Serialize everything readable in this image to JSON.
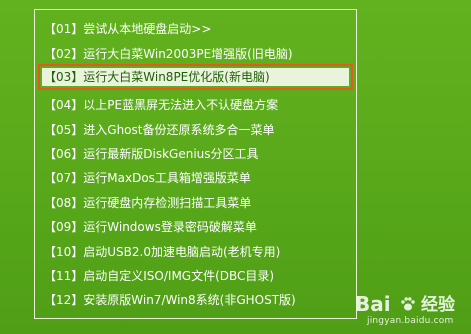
{
  "menu": {
    "items": [
      {
        "label": "【01】尝试从本地硬盘启动>>",
        "selected": false
      },
      {
        "label": "【02】运行大白菜Win2003PE增强版(旧电脑)",
        "selected": false
      },
      {
        "label": "【03】运行大白菜Win8PE优化版(新电脑)",
        "selected": true
      },
      {
        "label": "【04】以上PE蓝黑屏无法进入不认硬盘方案",
        "selected": false
      },
      {
        "label": "【05】进入Ghost备份还原系统多合一菜单",
        "selected": false
      },
      {
        "label": "【06】运行最新版DiskGenius分区工具",
        "selected": false
      },
      {
        "label": "【07】运行MaxDos工具箱增强版菜单",
        "selected": false
      },
      {
        "label": "【08】运行硬盘内存检测扫描工具菜单",
        "selected": false
      },
      {
        "label": "【09】运行Windows登录密码破解菜单",
        "selected": false
      },
      {
        "label": "【10】启动USB2.0加速电脑启动(老机专用)",
        "selected": false
      },
      {
        "label": "【11】启动自定义ISO/IMG文件(DBC目录)",
        "selected": false
      },
      {
        "label": "【12】安装原版Win7/Win8系统(非GHOST版)",
        "selected": false
      }
    ]
  },
  "watermark": {
    "logo": "Bai",
    "suffix": "经验",
    "url": "jingyan.baidu.com"
  },
  "colors": {
    "background": "#5cad1c",
    "selected_bg": "#eaf3db",
    "selected_text": "#1f5f0a",
    "highlight_border": "#e25a20",
    "text": "#ffffff"
  }
}
